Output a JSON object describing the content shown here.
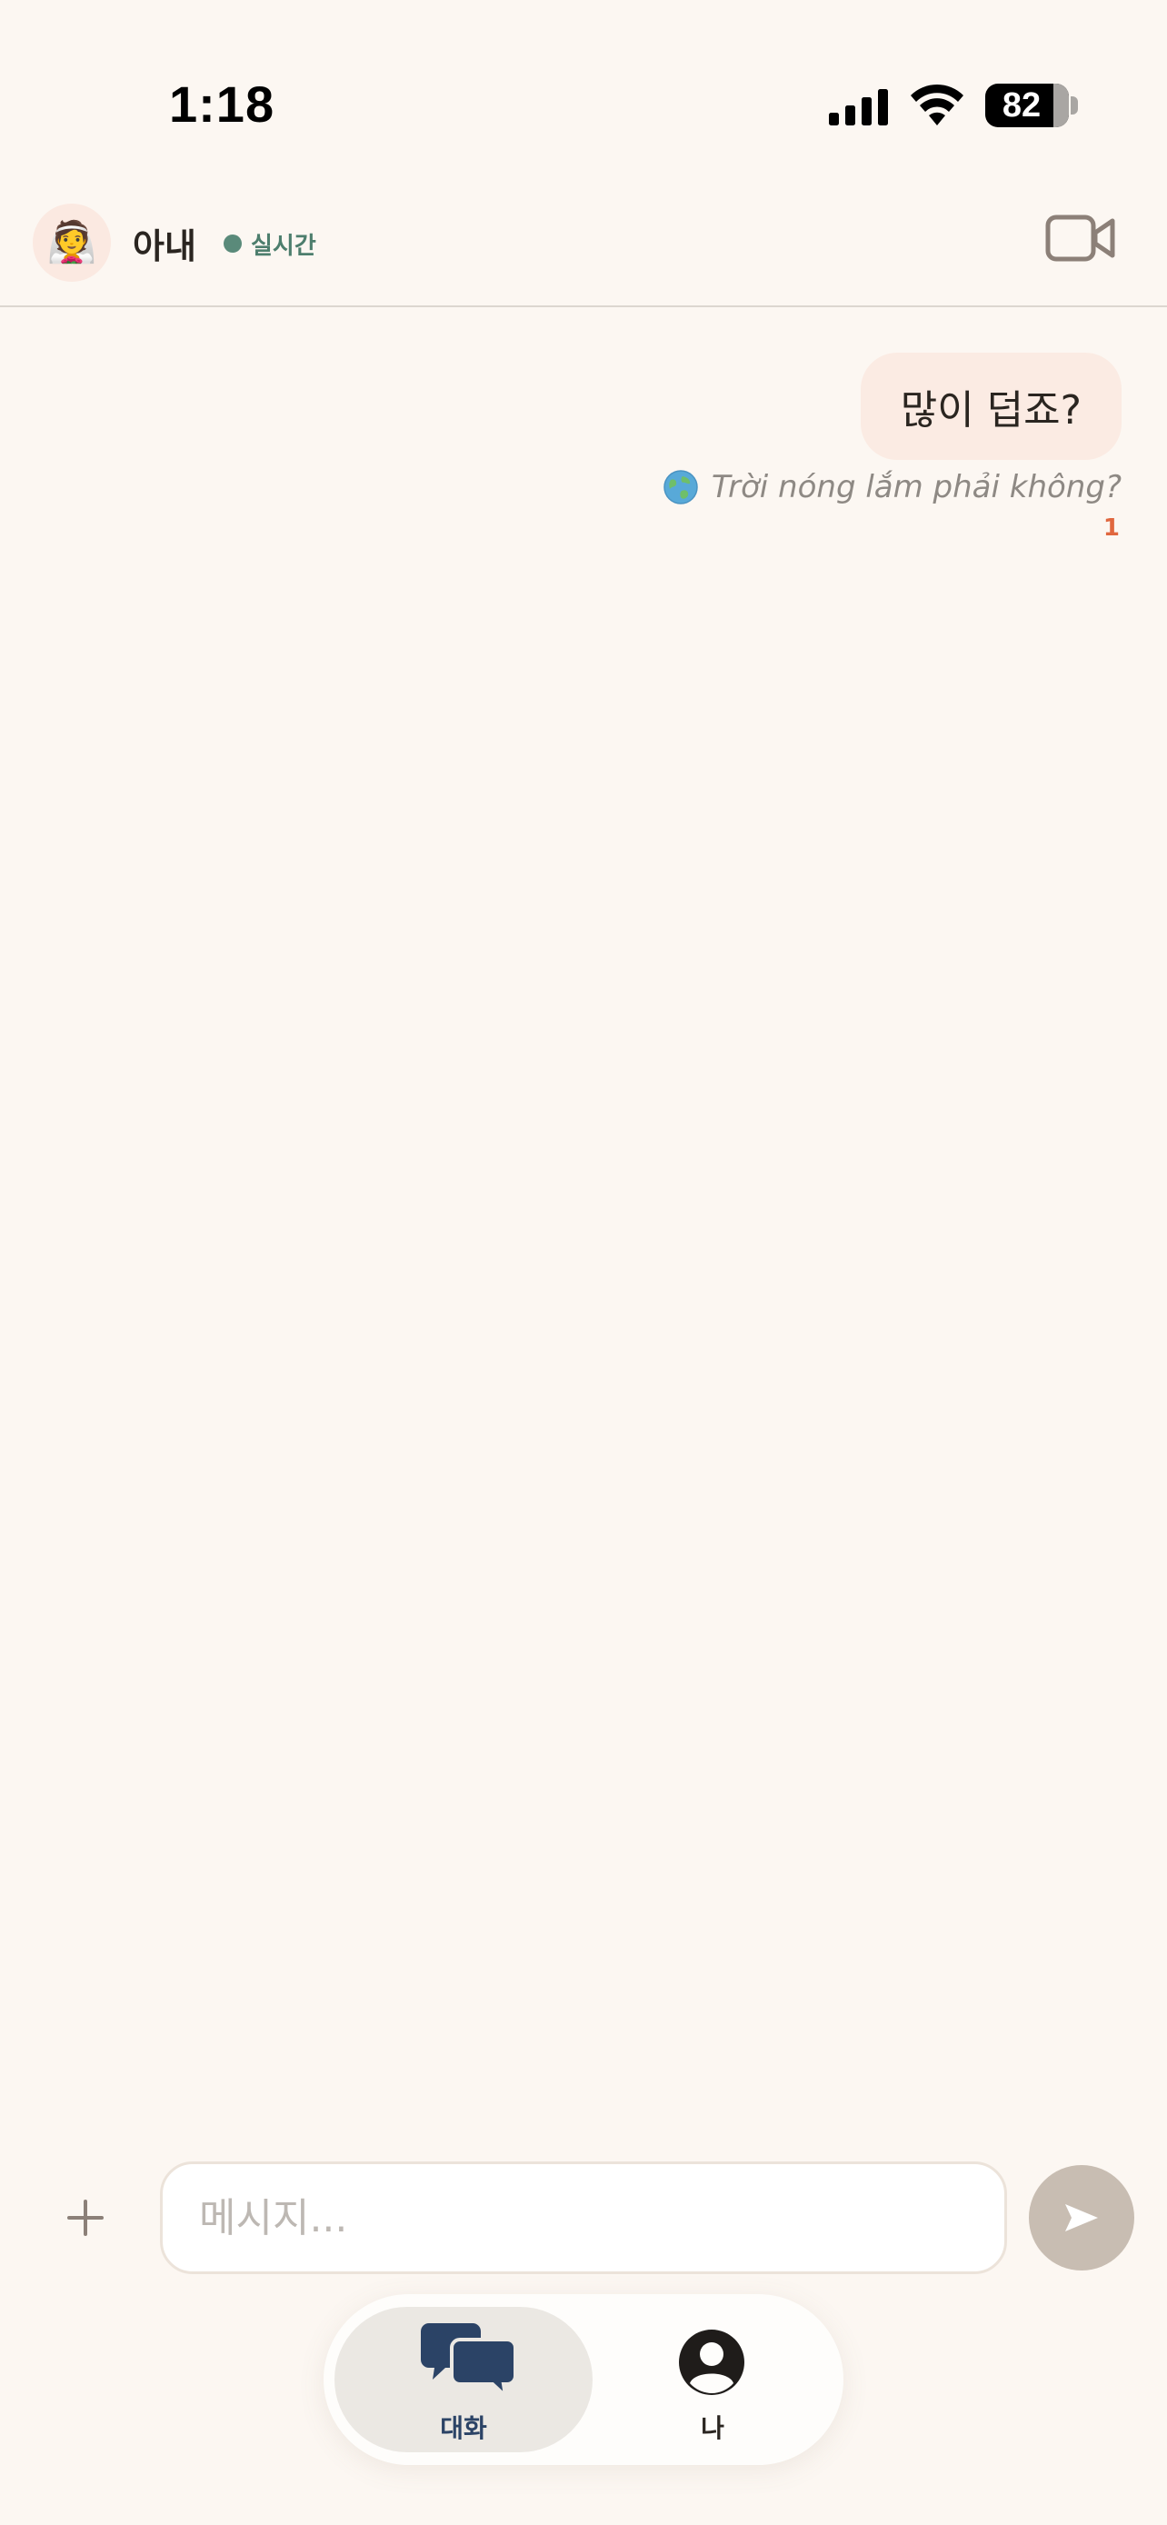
{
  "status_bar": {
    "time": "1:18",
    "battery_percent": 82
  },
  "header": {
    "avatar_emoji": "👰",
    "contact_name": "아내",
    "live_label": "실시간",
    "live_color": "#5a8a7a",
    "video_icon": "video-camera-icon"
  },
  "messages": [
    {
      "direction": "outgoing",
      "text": "많이 덥죠?",
      "translation": "Trời nóng lắm phải không?",
      "translation_icon": "globe-icon",
      "unread_count": "1"
    }
  ],
  "composer": {
    "plus_icon": "plus-icon",
    "placeholder": "메시지...",
    "value": "",
    "send_icon": "send-icon"
  },
  "tab_bar": {
    "tabs": [
      {
        "label": "대화",
        "icon": "chat-bubbles-icon",
        "active": true
      },
      {
        "label": "나",
        "icon": "profile-icon",
        "active": false
      }
    ]
  },
  "colors": {
    "background": "#fcf7f2",
    "bubble": "#fbebe3",
    "accent_navy": "#2b4366",
    "unread": "#e0673f",
    "send_button": "#c8bdb2"
  }
}
